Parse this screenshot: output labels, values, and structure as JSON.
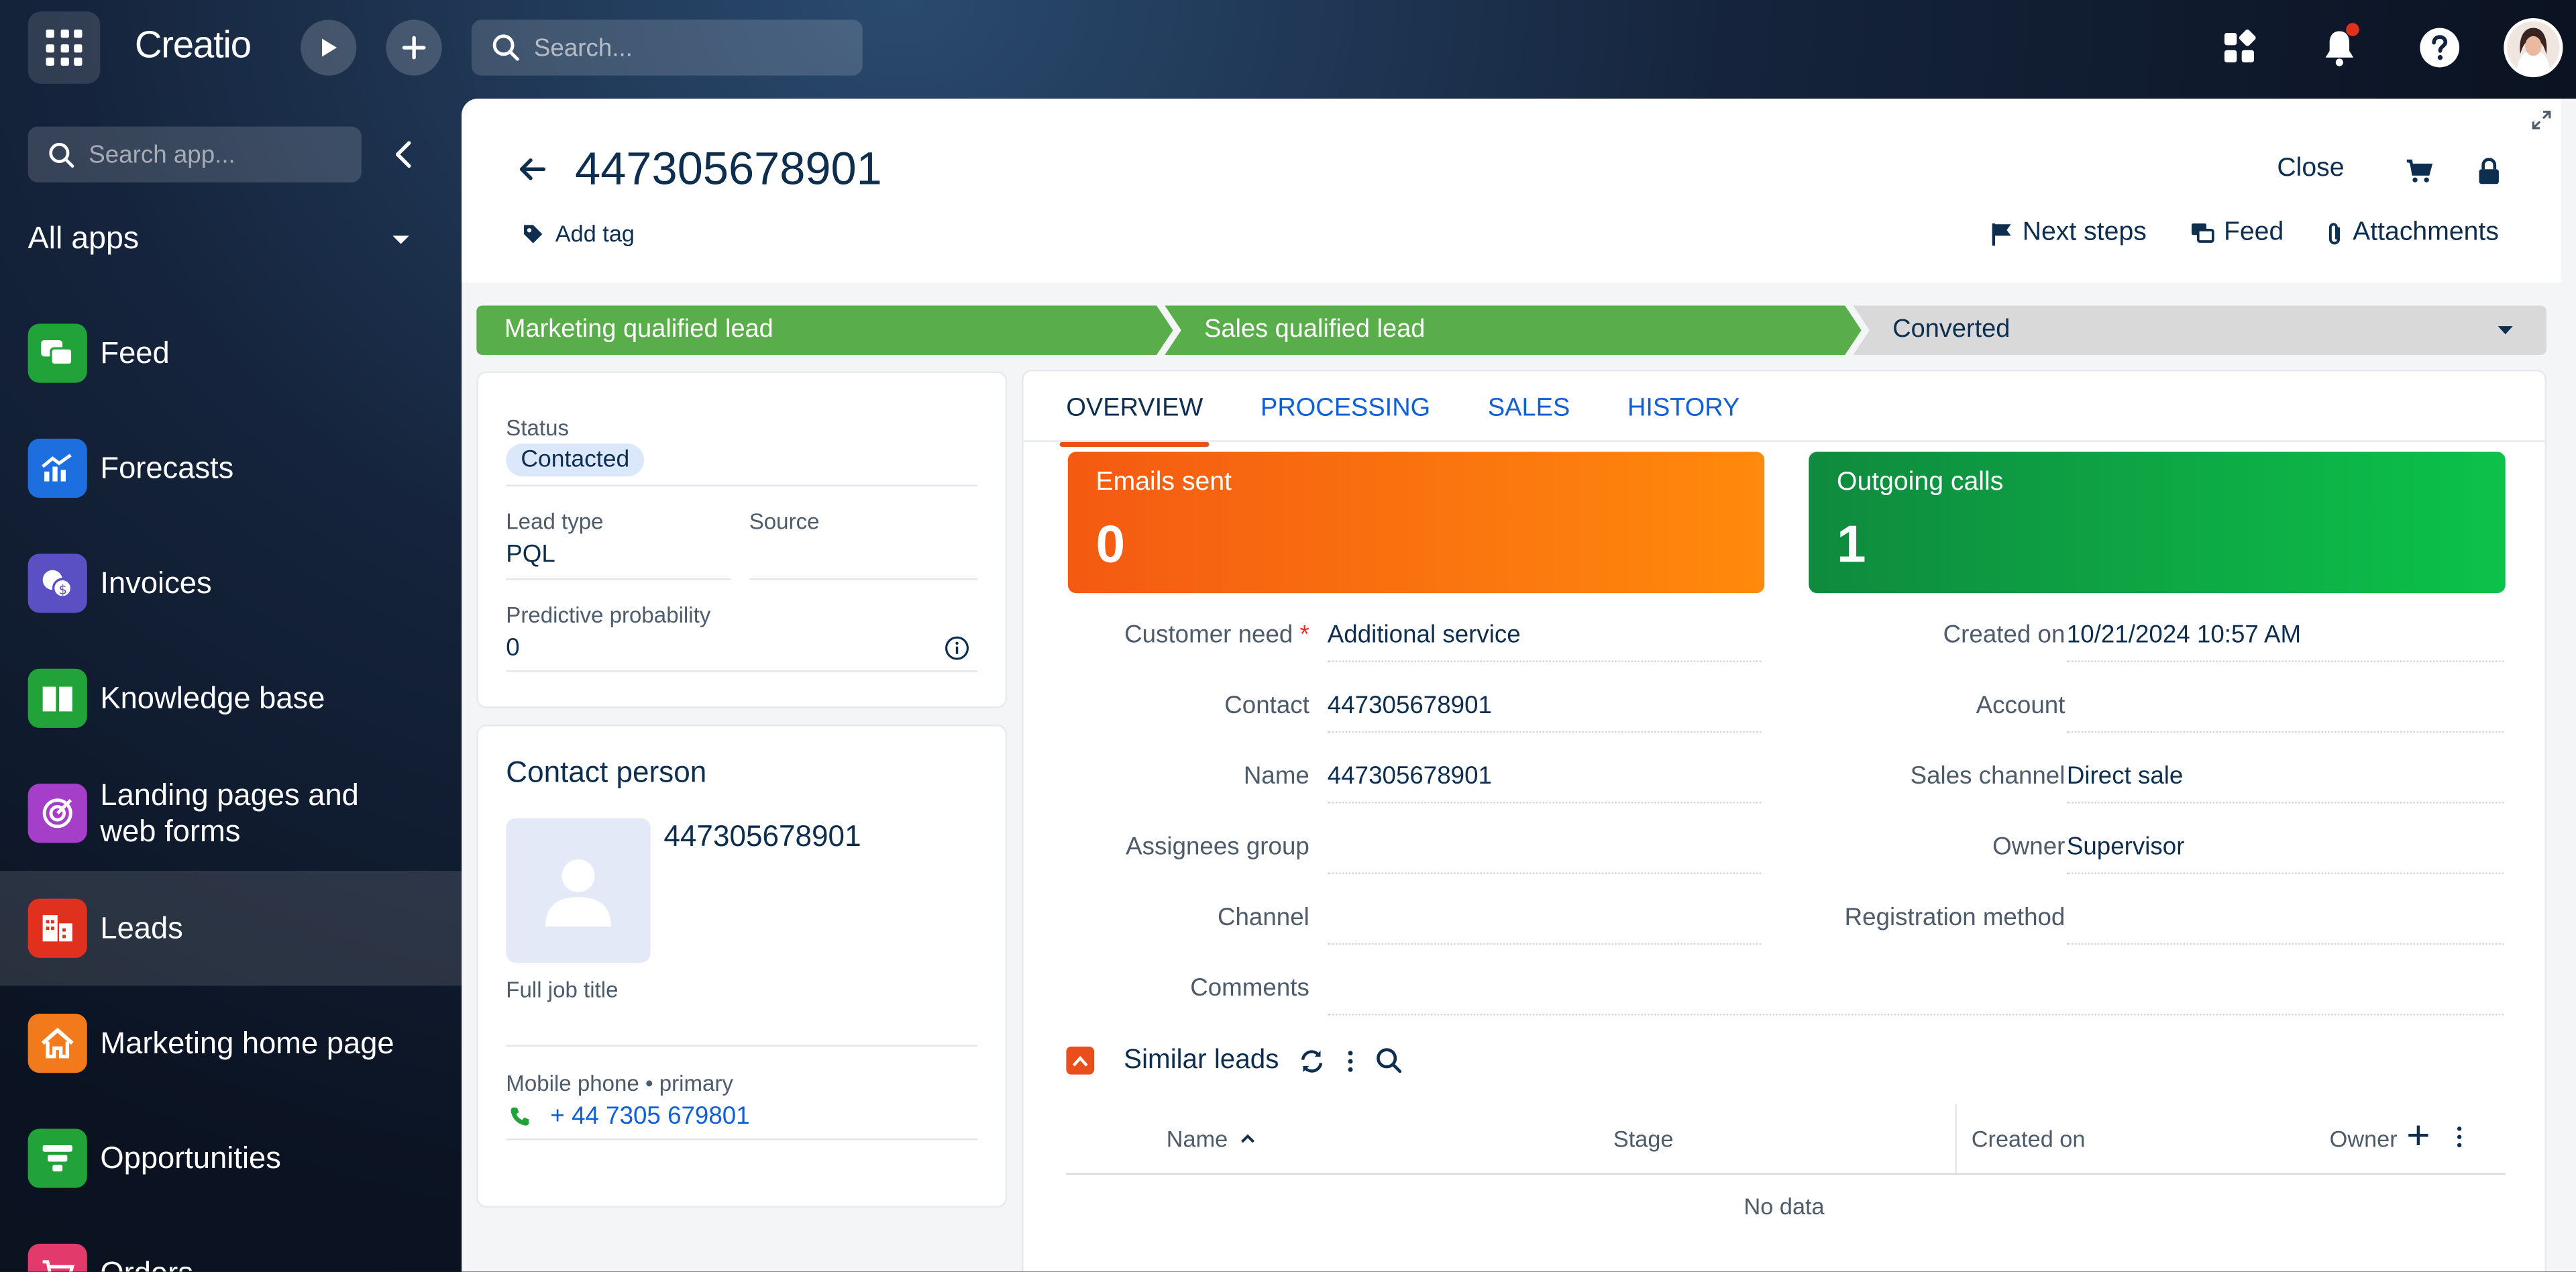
{
  "topbar": {
    "logo": "Creatio",
    "search_placeholder": "Search..."
  },
  "sidebar": {
    "search_placeholder": "Search app...",
    "all_apps": "All apps",
    "items": [
      {
        "label": "Feed",
        "color": "#22a33a",
        "icon": "feed-icon"
      },
      {
        "label": "Forecasts",
        "color": "#1d6fe0",
        "icon": "forecast-icon"
      },
      {
        "label": "Invoices",
        "color": "#5b4fc4",
        "icon": "invoice-icon"
      },
      {
        "label": "Knowledge base",
        "color": "#22a33a",
        "icon": "book-icon"
      },
      {
        "label": "Landing pages and web forms",
        "color": "#a53ec9",
        "icon": "target-icon"
      },
      {
        "label": "Leads",
        "color": "#e0301e",
        "icon": "leads-icon",
        "active": true
      },
      {
        "label": "Marketing home page",
        "color": "#f27a1a",
        "icon": "home-icon"
      },
      {
        "label": "Opportunities",
        "color": "#22a33a",
        "icon": "funnel-icon"
      },
      {
        "label": "Orders",
        "color": "#e23a6b",
        "icon": "cart-icon"
      }
    ]
  },
  "record": {
    "title": "447305678901",
    "add_tag": "Add tag",
    "close": "Close",
    "actions": {
      "next_steps": "Next steps",
      "feed": "Feed",
      "attachments": "Attachments"
    }
  },
  "stages": [
    {
      "label": "Marketing qualified lead",
      "state": "done"
    },
    {
      "label": "Sales qualified lead",
      "state": "done"
    },
    {
      "label": "Converted",
      "state": "pending"
    }
  ],
  "lead_card": {
    "status_label": "Status",
    "status_value": "Contacted",
    "lead_type_label": "Lead type",
    "lead_type_value": "PQL",
    "source_label": "Source",
    "source_value": "",
    "probability_label": "Predictive probability",
    "probability_value": "0"
  },
  "contact_card": {
    "title": "Contact person",
    "name": "447305678901",
    "job_title_label": "Full job title",
    "job_title_value": "",
    "phone_label": "Mobile phone • primary",
    "phone_value": "+ 44 7305 679801"
  },
  "tabs": [
    "OVERVIEW",
    "PROCESSING",
    "SALES",
    "HISTORY"
  ],
  "metrics": [
    {
      "label": "Emails sent",
      "value": "0"
    },
    {
      "label": "Outgoing calls",
      "value": "1"
    }
  ],
  "fields_left": [
    {
      "label": "Customer need",
      "value": "Additional service",
      "required": true,
      "link": true
    },
    {
      "label": "Contact",
      "value": "447305678901",
      "link": true
    },
    {
      "label": "Name",
      "value": "447305678901"
    },
    {
      "label": "Assignees group",
      "value": ""
    },
    {
      "label": "Channel",
      "value": ""
    },
    {
      "label": "Comments",
      "value": ""
    }
  ],
  "fields_right": [
    {
      "label": "Created on",
      "value": "10/21/2024 10:57 AM"
    },
    {
      "label": "Account",
      "value": ""
    },
    {
      "label": "Sales channel",
      "value": "Direct sale"
    },
    {
      "label": "Owner",
      "value": "Supervisor",
      "link": true
    },
    {
      "label": "Registration method",
      "value": ""
    }
  ],
  "similar_leads": {
    "title": "Similar leads",
    "columns": [
      "Name",
      "Stage",
      "Created on",
      "Owner"
    ],
    "empty": "No data"
  }
}
